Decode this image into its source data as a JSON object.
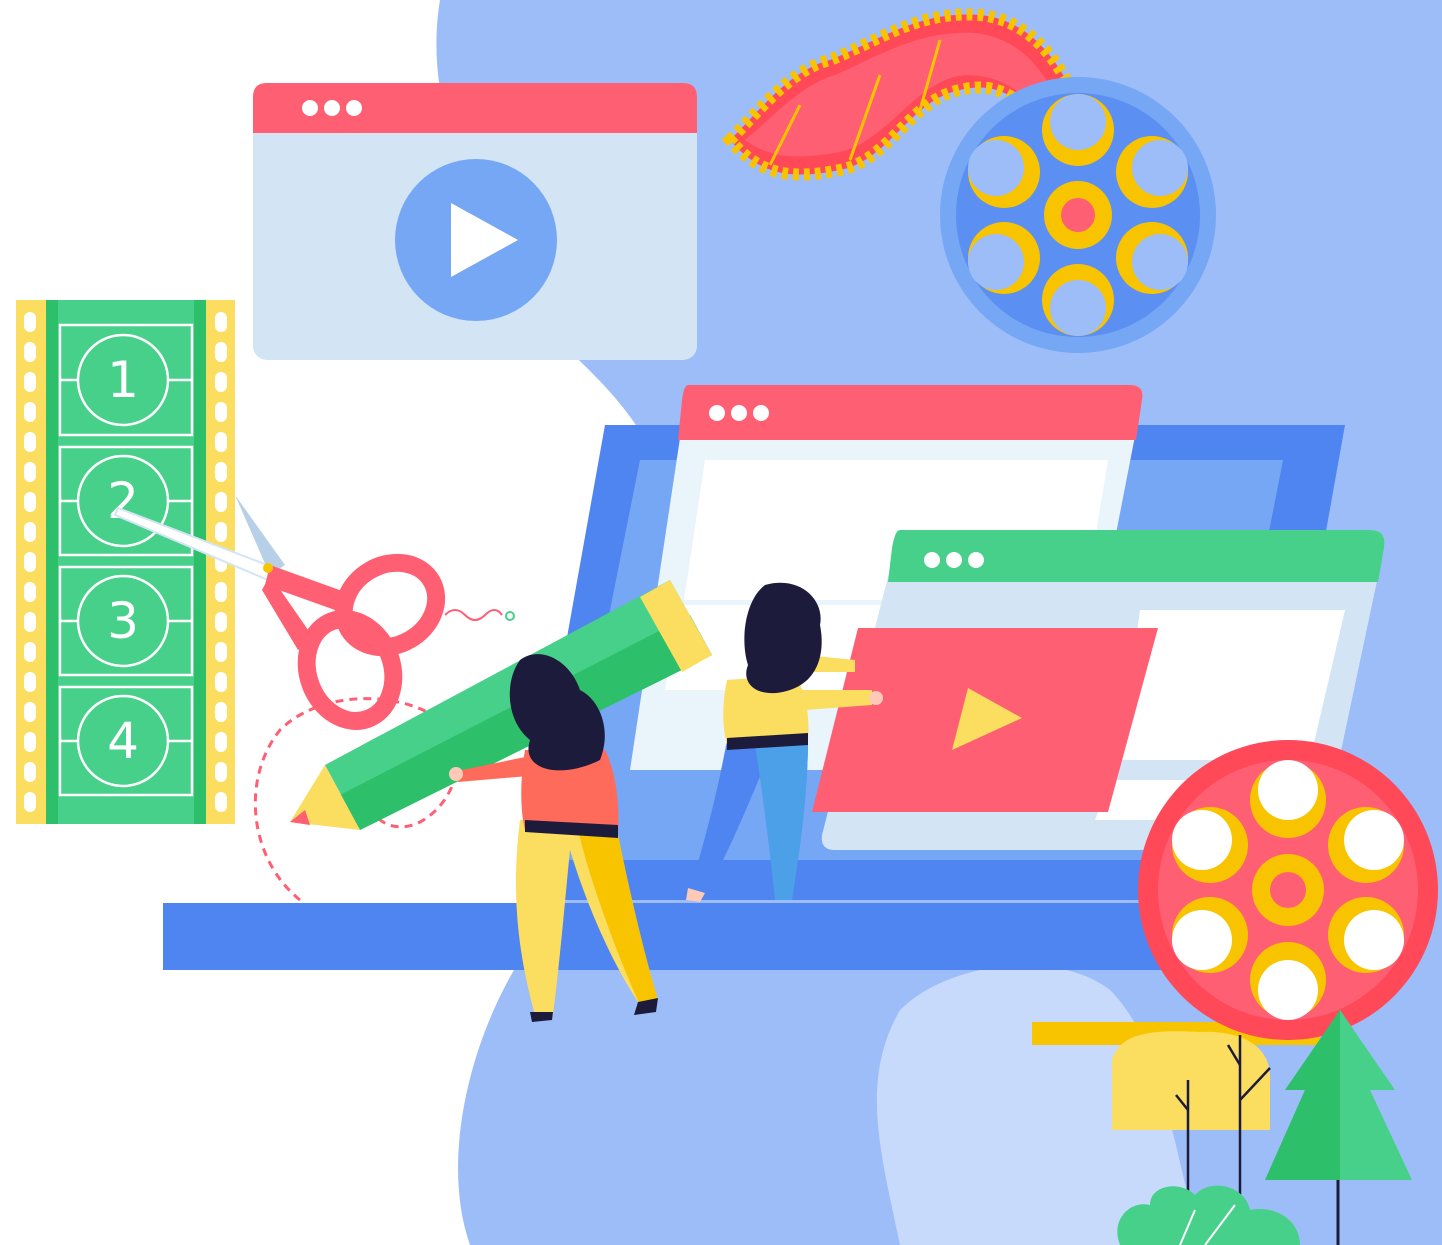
{
  "filmstrip": {
    "frames": [
      {
        "label": "1"
      },
      {
        "label": "2"
      },
      {
        "label": "3"
      },
      {
        "label": "4"
      }
    ]
  },
  "colors": {
    "background_blob": "#9DBDF8",
    "light_blob": "#C8DAFC",
    "laptop_blue": "#4F85F0",
    "laptop_screen": "#76A7F5",
    "red": "#FF5F73",
    "green": "#47D08A",
    "yellow": "#F8C400",
    "light_yellow": "#FBDD60",
    "navy": "#1D1B3B",
    "window_body": "#D3E5F5"
  },
  "icons": [
    "play-icon",
    "window-dots-icon",
    "film-reel-icon",
    "scissors-icon",
    "pencil-icon",
    "tree-icon"
  ]
}
